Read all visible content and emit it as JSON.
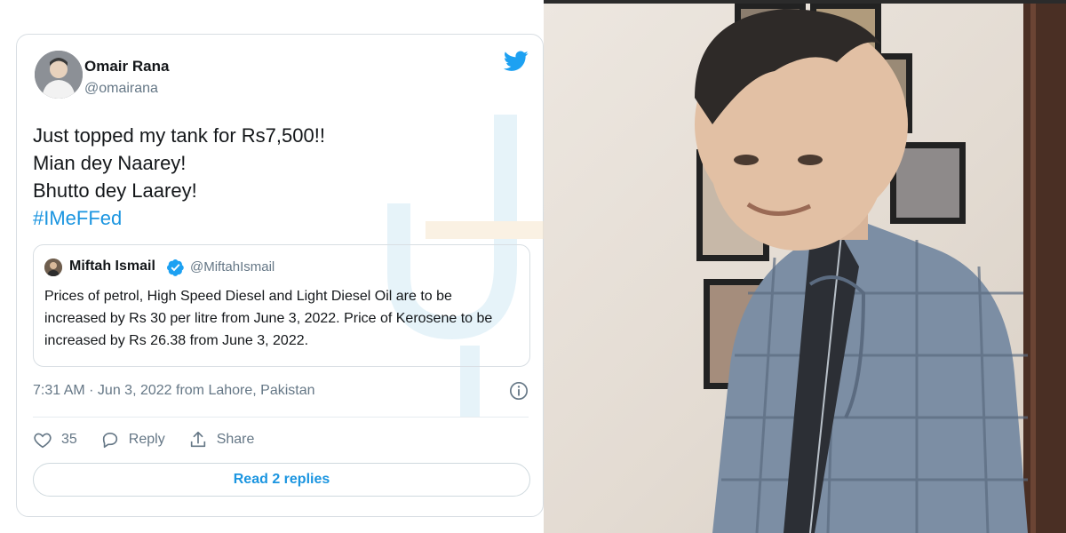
{
  "tweet": {
    "author_name": "Omair Rana",
    "author_handle": "@omairana",
    "lines": [
      "Just topped my tank for Rs7,500!!",
      "Mian dey Naarey!",
      "Bhutto dey Laarey!"
    ],
    "hashtag": "#IMeFFed",
    "timestamp": "7:31 AM · Jun 3, 2022 from Lahore, Pakistan",
    "likes": "35",
    "reply_label": "Reply",
    "share_label": "Share",
    "read_replies_label": "Read 2 replies"
  },
  "quoted_tweet": {
    "author_name": "Miftah Ismail",
    "author_handle": "@MiftahIsmail",
    "text": "Prices of petrol, High Speed Diesel and Light Diesel Oil are to be increased by Rs 30 per litre from June 3, 2022. Price of Kerosene to be increased by Rs 26.38 from June 3, 2022."
  },
  "colors": {
    "link_blue": "#1b95e0",
    "twitter_blue": "#1da1f2",
    "secondary_text": "#657786",
    "border": "#d8dee3"
  },
  "icons": [
    "twitter-bird-icon",
    "verified-badge-icon",
    "info-icon",
    "heart-icon",
    "reply-icon",
    "share-icon"
  ]
}
